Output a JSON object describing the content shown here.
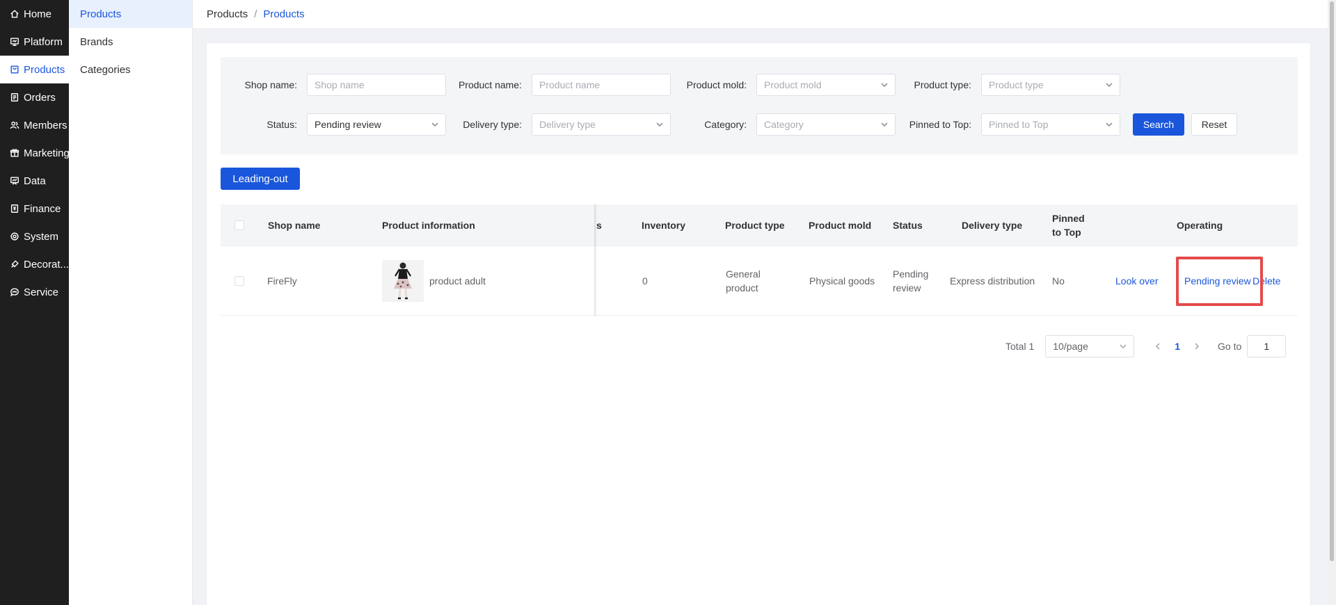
{
  "nav": {
    "items": [
      {
        "label": "Home",
        "icon": "home-icon"
      },
      {
        "label": "Platform",
        "icon": "monitor-icon"
      },
      {
        "label": "Products",
        "icon": "bag-icon"
      },
      {
        "label": "Orders",
        "icon": "document-icon"
      },
      {
        "label": "Members",
        "icon": "users-icon"
      },
      {
        "label": "Marketing",
        "icon": "gift-icon"
      },
      {
        "label": "Data",
        "icon": "chart-icon"
      },
      {
        "label": "Finance",
        "icon": "ledger-icon"
      },
      {
        "label": "System",
        "icon": "gear-icon"
      },
      {
        "label": "Decorat...",
        "icon": "brush-icon"
      },
      {
        "label": "Service",
        "icon": "chat-icon"
      }
    ]
  },
  "subnav": {
    "items": [
      {
        "label": "Products"
      },
      {
        "label": "Brands"
      },
      {
        "label": "Categories"
      }
    ]
  },
  "breadcrumb": {
    "first": "Products",
    "separator": "/",
    "current": "Products"
  },
  "filters": {
    "shop_name": {
      "label": "Shop name:",
      "placeholder": "Shop name"
    },
    "product_name": {
      "label": "Product name:",
      "placeholder": "Product name"
    },
    "product_mold": {
      "label": "Product mold:",
      "placeholder": "Product mold"
    },
    "product_type": {
      "label": "Product type:",
      "placeholder": "Product type"
    },
    "status": {
      "label": "Status:",
      "value": "Pending review"
    },
    "delivery_type": {
      "label": "Delivery type:",
      "placeholder": "Delivery type"
    },
    "category": {
      "label": "Category:",
      "placeholder": "Category"
    },
    "pinned": {
      "label": "Pinned to Top:",
      "placeholder": "Pinned to Top"
    },
    "search_label": "Search",
    "reset_label": "Reset"
  },
  "export_label": "Leading-out",
  "table": {
    "headers": {
      "shop_name": "Shop name",
      "product_info": "Product information",
      "clipped": "s",
      "inventory": "Inventory",
      "product_type": "Product type",
      "product_mold": "Product mold",
      "status": "Status",
      "delivery_type": "Delivery type",
      "pinned_line1": "Pinned",
      "pinned_line2": "to Top",
      "operating": "Operating"
    },
    "rows": [
      {
        "shop_name": "FireFly",
        "product_name": "product adult",
        "inventory": "0",
        "product_type_line1": "General",
        "product_type_line2": "product",
        "product_mold": "Physical goods",
        "status_line1": "Pending",
        "status_line2": "review",
        "delivery_type": "Express distribution",
        "pinned": "No",
        "actions": {
          "look": "Look over",
          "review": "Pending review",
          "delete": "Delete"
        }
      }
    ]
  },
  "pagination": {
    "total": "Total 1",
    "page_size": "10/page",
    "current": "1",
    "goto_label": "Go to",
    "goto_value": "1"
  },
  "colors": {
    "accent": "#1a56db",
    "sidebar": "#1f1f1f",
    "highlight": "#e34b4b"
  }
}
